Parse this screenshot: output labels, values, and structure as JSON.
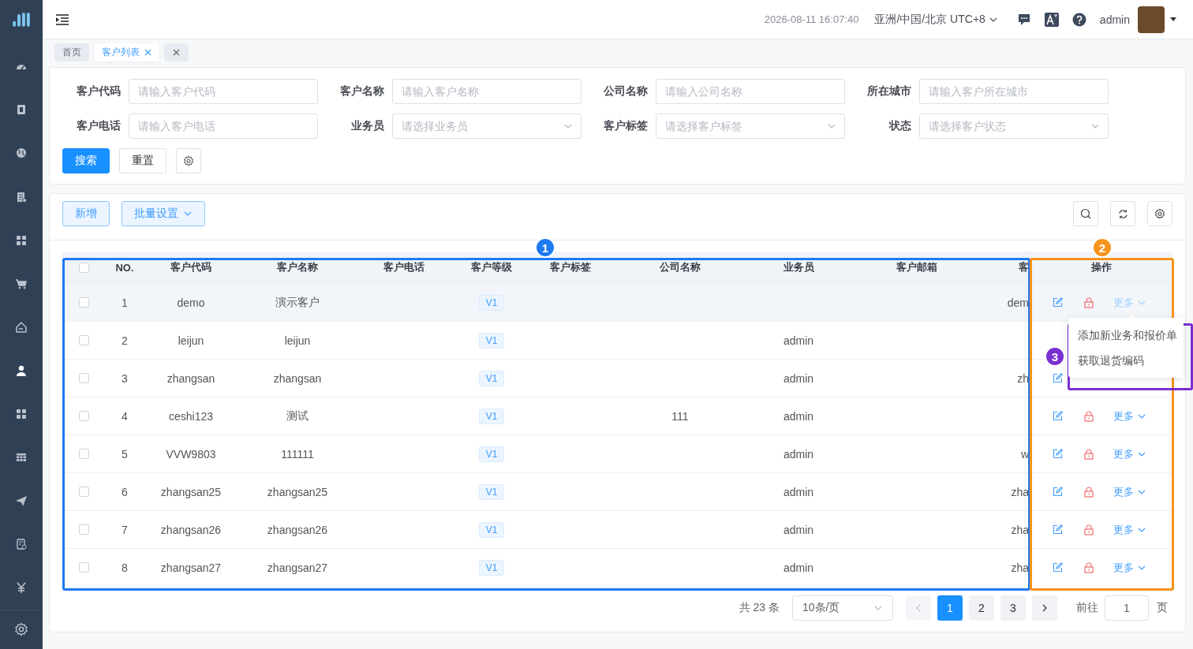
{
  "sidebar": {
    "items": [
      {
        "kind": "dashboard",
        "selected": false
      },
      {
        "kind": "badge",
        "selected": false
      },
      {
        "kind": "globe",
        "selected": false
      },
      {
        "kind": "report",
        "selected": false
      },
      {
        "kind": "apps",
        "selected": false
      },
      {
        "kind": "cart",
        "selected": false
      },
      {
        "kind": "home",
        "selected": false
      },
      {
        "kind": "user",
        "selected": true
      },
      {
        "kind": "apps",
        "selected": false
      },
      {
        "kind": "table",
        "selected": false
      },
      {
        "kind": "send",
        "selected": false
      },
      {
        "kind": "bill",
        "selected": false
      },
      {
        "kind": "yen",
        "selected": false
      }
    ]
  },
  "header": {
    "datetime": "2026-08-11 16:07:40",
    "timezone": "亚洲/中国/北京 UTC+8",
    "username": "admin"
  },
  "tags": [
    {
      "label": "首页",
      "selected": false,
      "closable": false
    },
    {
      "label": "客户列表",
      "selected": true,
      "closable": true
    }
  ],
  "filters": [
    {
      "label": "客户代码",
      "kind": "input",
      "placeholder": "请输入客户代码"
    },
    {
      "label": "客户名称",
      "kind": "input",
      "placeholder": "请输入客户名称"
    },
    {
      "label": "公司名称",
      "kind": "input",
      "placeholder": "请输入公司名称"
    },
    {
      "label": "所在城市",
      "kind": "input",
      "placeholder": "请输入客户所在城市"
    },
    {
      "label": "客户电话",
      "kind": "input",
      "placeholder": "请输入客户电话"
    },
    {
      "label": "业务员",
      "kind": "select",
      "placeholder": "请选择业务员"
    },
    {
      "label": "客户标签",
      "kind": "select",
      "placeholder": "请选择客户标签"
    },
    {
      "label": "状态",
      "kind": "select",
      "placeholder": "请选择客户状态"
    }
  ],
  "filter_buttons": {
    "search": "搜索",
    "reset": "重置"
  },
  "toolbar": {
    "add": "新增",
    "batch": "批量设置"
  },
  "table": {
    "select_all_checked": false,
    "columns": [
      "NO.",
      "客户代码",
      "客户名称",
      "客户电话",
      "客户等级",
      "客户标签",
      "公司名称",
      "业务员",
      "客户邮箱",
      "客",
      "操作"
    ],
    "rows": [
      {
        "checked": false,
        "hovered": true,
        "no": "1",
        "customer_code": "demo",
        "customer_name": "演示客户",
        "customer_level": "V1",
        "column_11": "dem",
        "actions": [
          {
            "kind": "edit"
          },
          {
            "kind": "lock"
          },
          {
            "kind": "more",
            "label": "更多",
            "open": true
          }
        ]
      },
      {
        "checked": false,
        "hovered": false,
        "no": "2",
        "customer_code": "leijun",
        "customer_name": "leijun",
        "customer_level": "V1",
        "salesperson": "admin",
        "actions": []
      },
      {
        "checked": false,
        "hovered": false,
        "no": "3",
        "customer_code": "zhangsan",
        "customer_name": "zhangsan",
        "customer_level": "V1",
        "salesperson": "admin",
        "column_11": "zh",
        "actions": [
          {
            "kind": "edit"
          }
        ]
      },
      {
        "checked": false,
        "hovered": false,
        "no": "4",
        "customer_code": "ceshi123",
        "customer_name": "测试",
        "customer_level": "V1",
        "company_name": "111",
        "salesperson": "admin",
        "actions": [
          {
            "kind": "edit"
          },
          {
            "kind": "lock"
          },
          {
            "kind": "more",
            "label": "更多",
            "open": false
          }
        ]
      },
      {
        "checked": false,
        "hovered": false,
        "no": "5",
        "customer_code": "VVW9803",
        "customer_name": "111111",
        "customer_level": "V1",
        "salesperson": "admin",
        "column_11": "w",
        "actions": [
          {
            "kind": "edit"
          },
          {
            "kind": "lock"
          },
          {
            "kind": "more",
            "label": "更多",
            "open": false
          }
        ]
      },
      {
        "checked": false,
        "hovered": false,
        "no": "6",
        "customer_code": "zhangsan25",
        "customer_name": "zhangsan25",
        "customer_level": "V1",
        "salesperson": "admin",
        "column_11": "zha",
        "actions": [
          {
            "kind": "edit"
          },
          {
            "kind": "lock"
          },
          {
            "kind": "more",
            "label": "更多",
            "open": false
          }
        ]
      },
      {
        "checked": false,
        "hovered": false,
        "no": "7",
        "customer_code": "zhangsan26",
        "customer_name": "zhangsan26",
        "customer_level": "V1",
        "salesperson": "admin",
        "column_11": "zha",
        "actions": [
          {
            "kind": "edit"
          },
          {
            "kind": "lock"
          },
          {
            "kind": "more",
            "label": "更多",
            "open": false
          }
        ]
      },
      {
        "checked": false,
        "hovered": false,
        "no": "8",
        "customer_code": "zhangsan27",
        "customer_name": "zhangsan27",
        "customer_level": "V1",
        "salesperson": "admin",
        "column_11": "zha",
        "actions": [
          {
            "kind": "edit"
          },
          {
            "kind": "lock"
          },
          {
            "kind": "more",
            "label": "更多",
            "open": false
          }
        ]
      }
    ],
    "row_menu": {
      "items": [
        "添加新业务和报价单",
        "获取退货编码"
      ]
    }
  },
  "pagination": {
    "total": "共 23 条",
    "page_size": "10条/页",
    "prev_disabled": true,
    "next_disabled": false,
    "pages": [
      {
        "label": "1",
        "selected": true
      },
      {
        "label": "2",
        "selected": false
      },
      {
        "label": "3",
        "selected": false
      }
    ],
    "goto_label": "前往",
    "goto_value": "1",
    "page_unit": "页"
  },
  "annotations": [
    {
      "label": "1",
      "color": "#1d7af3"
    },
    {
      "label": "2",
      "color": "#f7931e"
    },
    {
      "label": "3",
      "color": "#7a2fd1"
    }
  ]
}
